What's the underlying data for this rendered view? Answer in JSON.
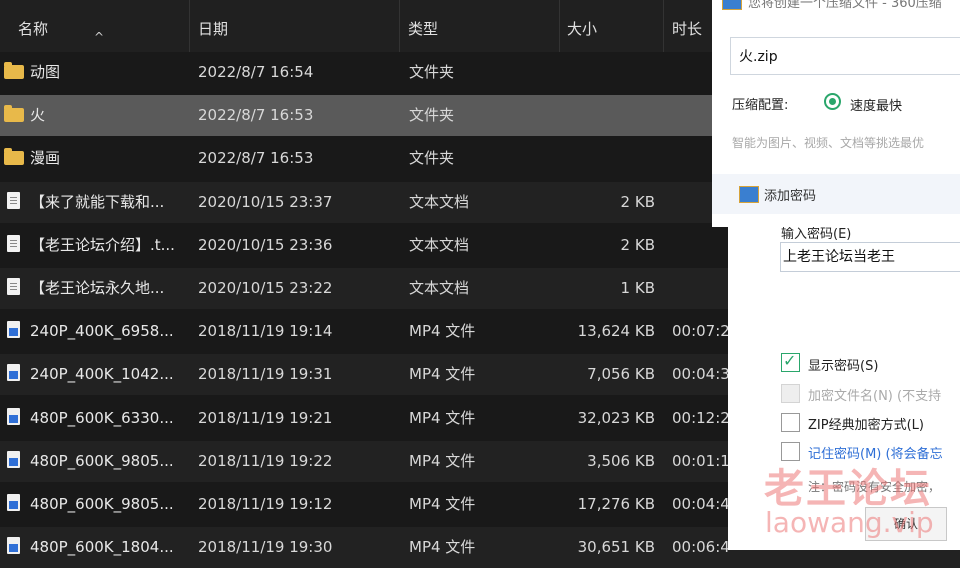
{
  "columns": {
    "name": "名称",
    "date": "日期",
    "type": "类型",
    "size": "大小",
    "duration": "时长"
  },
  "files": [
    {
      "icon": "folder-icon",
      "name": "动图",
      "date": "2022/8/7 16:54",
      "type": "文件夹",
      "size": "",
      "duration": ""
    },
    {
      "icon": "folder-icon",
      "name": "火",
      "date": "2022/8/7 16:53",
      "type": "文件夹",
      "size": "",
      "duration": "",
      "selected": true
    },
    {
      "icon": "folder-icon",
      "name": "漫画",
      "date": "2022/8/7 16:53",
      "type": "文件夹",
      "size": "",
      "duration": ""
    },
    {
      "icon": "text-file-icon",
      "name": "【来了就能下载和...",
      "date": "2020/10/15 23:37",
      "type": "文本文档",
      "size": "2 KB",
      "duration": ""
    },
    {
      "icon": "text-file-icon",
      "name": "【老王论坛介绍】.t...",
      "date": "2020/10/15 23:36",
      "type": "文本文档",
      "size": "2 KB",
      "duration": ""
    },
    {
      "icon": "text-file-icon",
      "name": "【老王论坛永久地...",
      "date": "2020/10/15 23:22",
      "type": "文本文档",
      "size": "1 KB",
      "duration": ""
    },
    {
      "icon": "video-file-icon",
      "name": "240P_400K_6958...",
      "date": "2018/11/19 19:14",
      "type": "MP4 文件",
      "size": "13,624 KB",
      "duration": "00:07:2"
    },
    {
      "icon": "video-file-icon",
      "name": "240P_400K_1042...",
      "date": "2018/11/19 19:31",
      "type": "MP4 文件",
      "size": "7,056 KB",
      "duration": "00:04:3"
    },
    {
      "icon": "video-file-icon",
      "name": "480P_600K_6330...",
      "date": "2018/11/19 19:21",
      "type": "MP4 文件",
      "size": "32,023 KB",
      "duration": "00:12:2"
    },
    {
      "icon": "video-file-icon",
      "name": "480P_600K_9805...",
      "date": "2018/11/19 19:22",
      "type": "MP4 文件",
      "size": "3,506 KB",
      "duration": "00:01:1"
    },
    {
      "icon": "video-file-icon",
      "name": "480P_600K_9805...",
      "date": "2018/11/19 19:12",
      "type": "MP4 文件",
      "size": "17,276 KB",
      "duration": "00:04:4"
    },
    {
      "icon": "video-file-icon",
      "name": "480P_600K_1804...",
      "date": "2018/11/19 19:30",
      "type": "MP4 文件",
      "size": "30,651 KB",
      "duration": "00:06:4"
    }
  ],
  "dialog": {
    "title": "您将创建一个压缩文件 - 360压缩",
    "filename": "火.zip",
    "config_label": "压缩配置:",
    "config_value": "速度最快",
    "hint": "智能为图片、视频、文档等挑选最优",
    "add_password": "添加密码"
  },
  "password_dialog": {
    "label": "输入密码(E)",
    "value": "上老王论坛当老王",
    "show_password": "显示密码(S)",
    "encrypt_names": "加密文件名(N) (不支持",
    "zip_classic": "ZIP经典加密方式(L)",
    "remember": "记住密码(M) (将会备忘",
    "note": "注：密码没有安全加密，",
    "ok": "确认"
  },
  "watermark": {
    "line1": "老王论坛",
    "line2": "laowang.vip"
  },
  "colors": {
    "folder": "#e8b94a",
    "selected_row": "#5a5a5a",
    "accent_green": "#2aa66b",
    "link_blue": "#2f6fd6"
  }
}
